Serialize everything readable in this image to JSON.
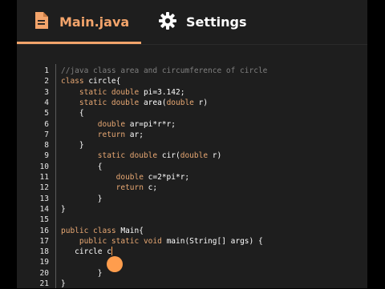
{
  "tabs": {
    "main_label": "Main.java",
    "settings_label": "Settings"
  },
  "colors": {
    "tab_active": "#f3a46b",
    "tab_inactive": "#ffffff",
    "comment": "#7f7f7f",
    "keyword": "#e8a873",
    "text": "#ffffff",
    "line_number": "#e6e6e6",
    "touch": "#ff9d4d"
  },
  "icons": {
    "main_tab": "file-icon",
    "settings_tab": "gear-icon"
  },
  "editor": {
    "lines": [
      {
        "n": "1",
        "tokens": [
          {
            "t": "//java class area and circumference of circle",
            "k": "comment"
          }
        ]
      },
      {
        "n": "2",
        "tokens": [
          {
            "t": "class ",
            "k": "keyword"
          },
          {
            "t": "circle{",
            "k": "text"
          }
        ]
      },
      {
        "n": "3",
        "tokens": [
          {
            "t": "    static double ",
            "k": "keyword"
          },
          {
            "t": "pi=3.142;",
            "k": "text"
          }
        ]
      },
      {
        "n": "4",
        "tokens": [
          {
            "t": "    static double ",
            "k": "keyword"
          },
          {
            "t": "area(",
            "k": "text"
          },
          {
            "t": "double ",
            "k": "keyword"
          },
          {
            "t": "r)",
            "k": "text"
          }
        ]
      },
      {
        "n": "5",
        "tokens": [
          {
            "t": "    {",
            "k": "text"
          }
        ]
      },
      {
        "n": "6",
        "tokens": [
          {
            "t": "        double ",
            "k": "keyword"
          },
          {
            "t": "ar=pi*r*r;",
            "k": "text"
          }
        ]
      },
      {
        "n": "7",
        "tokens": [
          {
            "t": "        return ",
            "k": "keyword"
          },
          {
            "t": "ar;",
            "k": "text"
          }
        ]
      },
      {
        "n": "8",
        "tokens": [
          {
            "t": "    }",
            "k": "text"
          }
        ]
      },
      {
        "n": "9",
        "tokens": [
          {
            "t": "        static double ",
            "k": "keyword"
          },
          {
            "t": "cir(",
            "k": "text"
          },
          {
            "t": "double ",
            "k": "keyword"
          },
          {
            "t": "r)",
            "k": "text"
          }
        ]
      },
      {
        "n": "10",
        "tokens": [
          {
            "t": "        {",
            "k": "text"
          }
        ]
      },
      {
        "n": "11",
        "tokens": [
          {
            "t": "            double ",
            "k": "keyword"
          },
          {
            "t": "c=2*pi*r;",
            "k": "text"
          }
        ]
      },
      {
        "n": "12",
        "tokens": [
          {
            "t": "            return ",
            "k": "keyword"
          },
          {
            "t": "c;",
            "k": "text"
          }
        ]
      },
      {
        "n": "13",
        "tokens": [
          {
            "t": "        }",
            "k": "text"
          }
        ]
      },
      {
        "n": "14",
        "tokens": [
          {
            "t": "}",
            "k": "text"
          }
        ]
      },
      {
        "n": "15",
        "tokens": []
      },
      {
        "n": "16",
        "tokens": [
          {
            "t": "public class ",
            "k": "keyword"
          },
          {
            "t": "Main{",
            "k": "text"
          }
        ]
      },
      {
        "n": "17",
        "tokens": [
          {
            "t": "    public static void ",
            "k": "keyword"
          },
          {
            "t": "main(String[] args) {",
            "k": "text"
          }
        ]
      },
      {
        "n": "18",
        "tokens": [
          {
            "t": "   circle c",
            "k": "text"
          }
        ],
        "cursor": true
      },
      {
        "n": "19",
        "tokens": []
      },
      {
        "n": "20",
        "tokens": [
          {
            "t": "        }",
            "k": "text"
          }
        ]
      },
      {
        "n": "21",
        "tokens": [
          {
            "t": "}",
            "k": "text"
          }
        ]
      }
    ]
  }
}
